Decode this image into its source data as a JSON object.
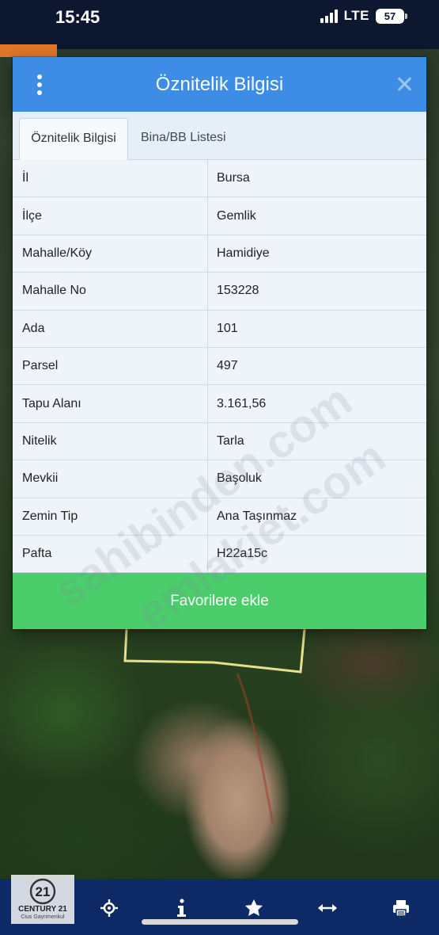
{
  "status_bar": {
    "time": "15:45",
    "network": "LTE",
    "battery": "57"
  },
  "dialog": {
    "title": "Öznitelik Bilgisi",
    "tabs": [
      {
        "label": "Öznitelik Bilgisi",
        "active": true
      },
      {
        "label": "Bina/BB Listesi",
        "active": false
      }
    ],
    "rows": [
      {
        "key": "İl",
        "value": "Bursa"
      },
      {
        "key": "İlçe",
        "value": "Gemlik"
      },
      {
        "key": "Mahalle/Köy",
        "value": "Hamidiye"
      },
      {
        "key": "Mahalle No",
        "value": "153228"
      },
      {
        "key": "Ada",
        "value": "101"
      },
      {
        "key": "Parsel",
        "value": "497"
      },
      {
        "key": "Tapu Alanı",
        "value": "3.161,56"
      },
      {
        "key": "Nitelik",
        "value": "Tarla"
      },
      {
        "key": "Mevkii",
        "value": "Başoluk"
      },
      {
        "key": "Zemin Tip",
        "value": "Ana Taşınmaz"
      },
      {
        "key": "Pafta",
        "value": "H22a15c"
      }
    ],
    "favorite_button": "Favorilere ekle"
  },
  "watermarks": [
    "sahibinden.com",
    "emlakjet.com"
  ],
  "brand_logo": {
    "number": "21",
    "name": "CENTURY 21",
    "subtitle": "Cius Gayrimenkul"
  },
  "toolbar": {
    "icons": [
      "locate-icon",
      "info-icon",
      "star-icon",
      "measure-icon",
      "print-icon"
    ]
  },
  "colors": {
    "header": "#3d8de6",
    "favorite": "#4ccd6c",
    "toolbar": "#0e2a66",
    "accent_orange": "#e07628"
  }
}
